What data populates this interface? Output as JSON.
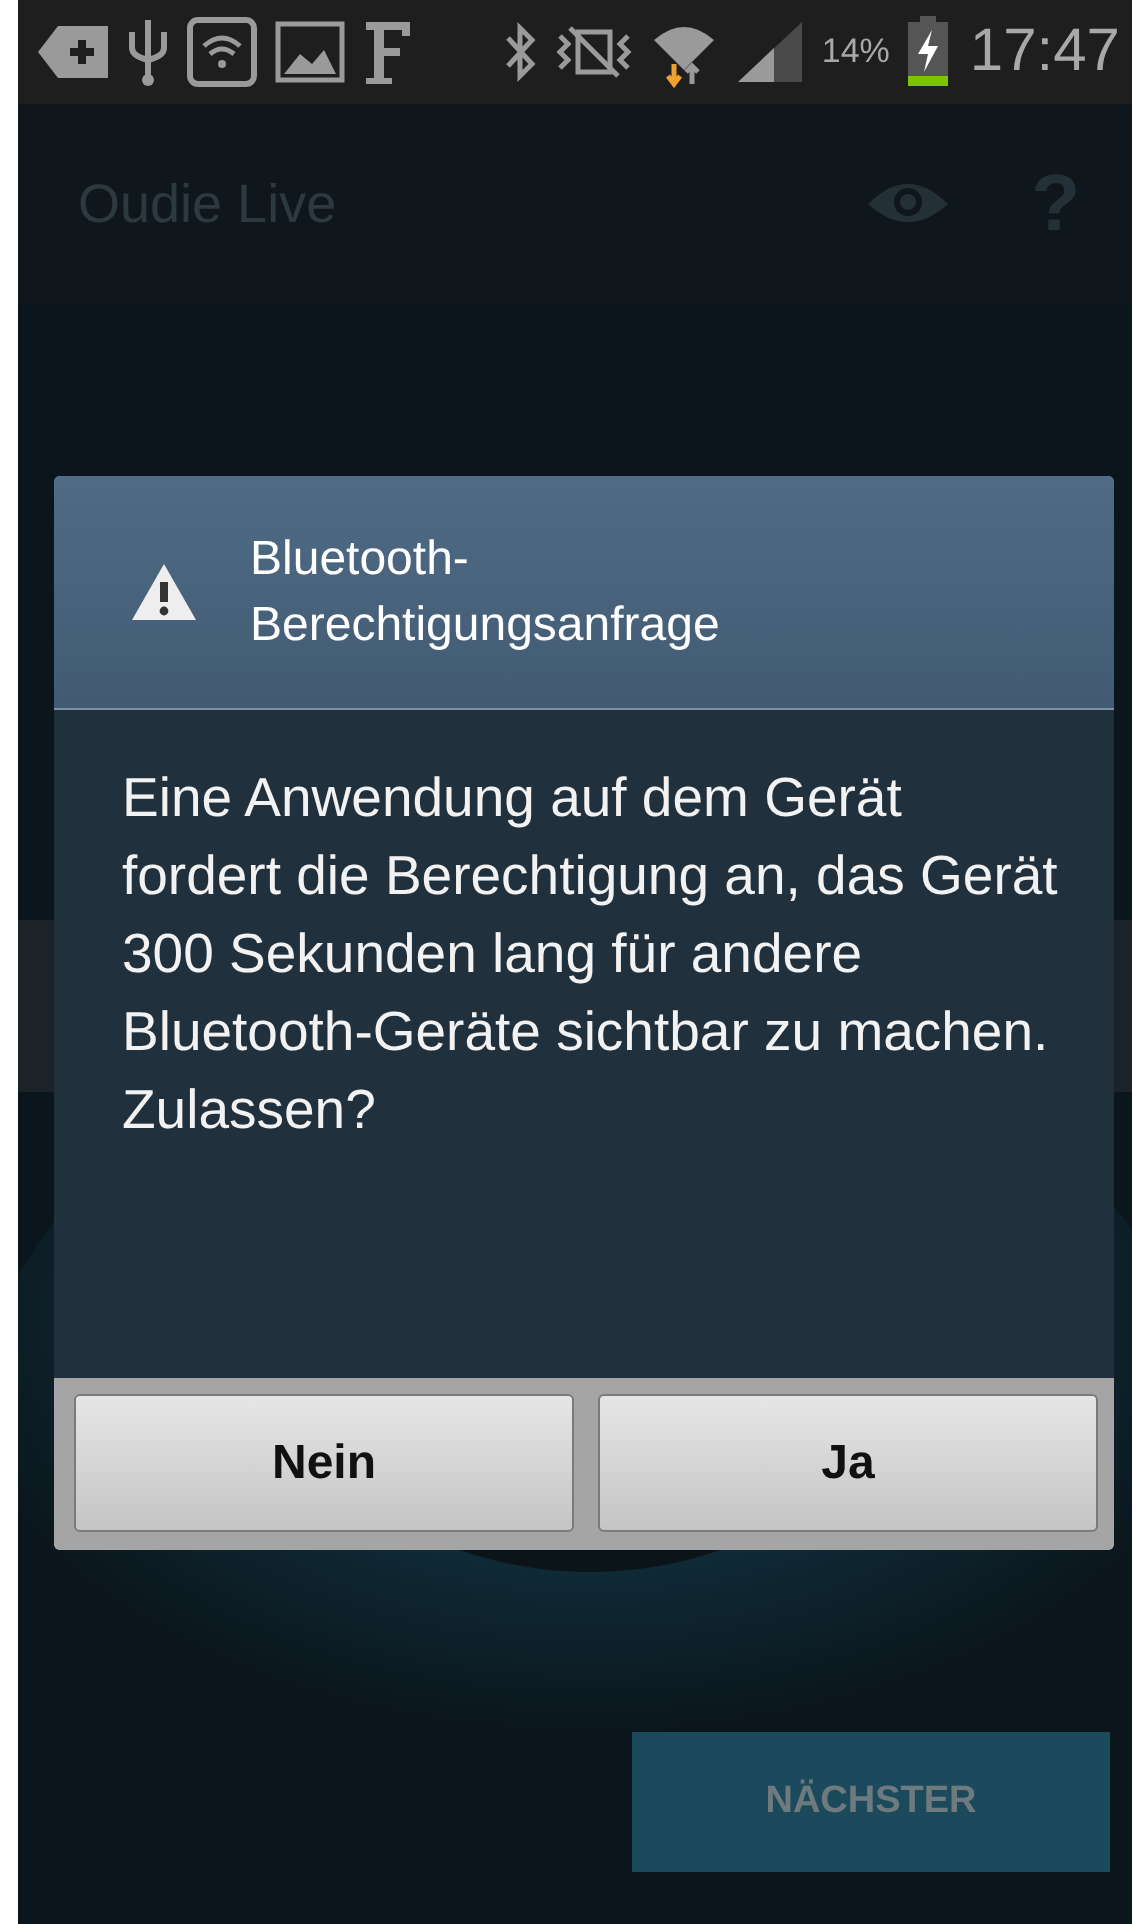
{
  "status_bar": {
    "battery_percent": "14%",
    "time": "17:47"
  },
  "app_bar": {
    "title": "Oudie Live",
    "help": "?"
  },
  "dialog": {
    "title": "Bluetooth-\nBerechtigungsanfrage",
    "message": "Eine Anwendung auf dem Gerät fordert die Berechtigung an, das Gerät 300 Sekunden lang für andere Bluetooth-Geräte sichtbar zu machen. Zulassen?",
    "buttons": [
      {
        "label": "Nein"
      },
      {
        "label": "Ja"
      }
    ]
  },
  "next_button": {
    "label": "NÄCHSTER",
    "disabled": true
  }
}
